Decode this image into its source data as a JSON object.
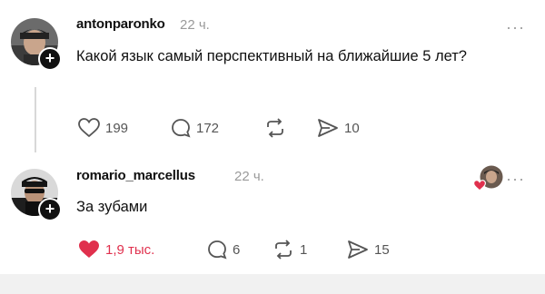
{
  "post": {
    "username": "antonparonko",
    "time": "22 ч.",
    "text": "Какой язык самый перспективный на ближайшие 5 лет?",
    "likes": "199",
    "replies": "172",
    "reposts": "",
    "shares": "10",
    "more_icon": "ellipsis-icon"
  },
  "reply": {
    "username": "romario_marcellus",
    "time": "22 ч.",
    "text": "За зубами",
    "likes": "1,9 тыс.",
    "replies": "6",
    "reposts": "1",
    "shares": "15",
    "liked_color": "#e0304d",
    "more_icon": "ellipsis-icon"
  },
  "icons": {
    "follow": "+",
    "more": "···"
  }
}
